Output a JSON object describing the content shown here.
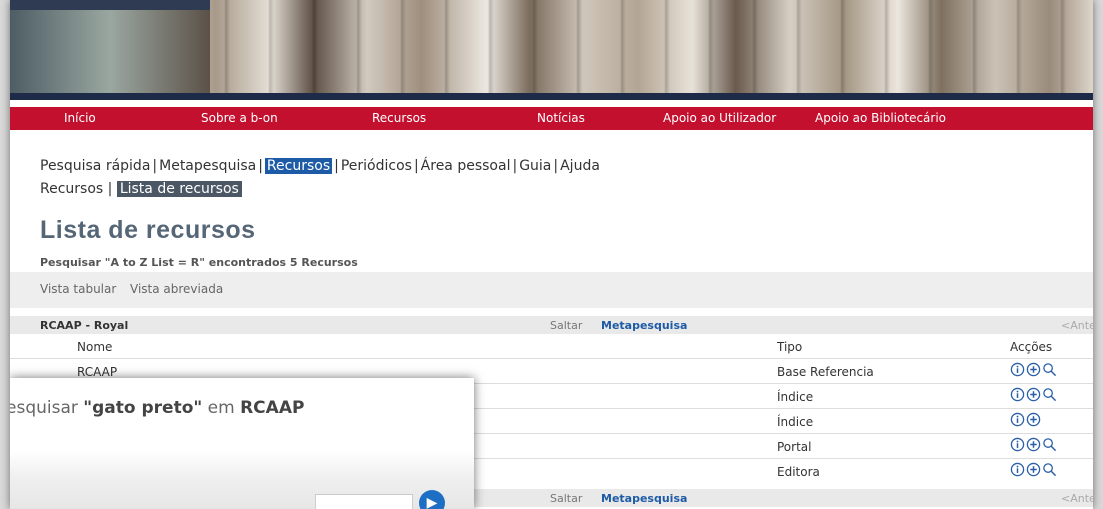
{
  "nav": {
    "items": [
      "Início",
      "Sobre a b-on",
      "Recursos",
      "Notícias",
      "Apoio ao Utilizador",
      "Apoio ao Bibliotecário"
    ]
  },
  "tabs": {
    "items": [
      "Pesquisa rápida",
      "Metapesquisa",
      "Recursos",
      "Periódicos",
      "Área pessoal",
      "Guia",
      "Ajuda"
    ],
    "active": "Recursos"
  },
  "breadcrumb": {
    "root": "Recursos",
    "current": "Lista de recursos"
  },
  "page": {
    "title": "Lista de recursos",
    "subtitle": "Pesquisar \"A to Z List = R\" encontrados 5 Recursos"
  },
  "views": {
    "tabular": "Vista tabular",
    "abreviada": "Vista abreviada"
  },
  "group": {
    "name": "RCAAP - Royal",
    "saltar": "Saltar",
    "metapesquisa": "Metapesquisa",
    "anterior": "<Anter"
  },
  "columns": {
    "nome": "Nome",
    "tipo": "Tipo",
    "accoes": "Acções"
  },
  "rows": [
    {
      "nome": "RCAAP",
      "tipo": "Base Referencia",
      "icons": [
        "info-icon",
        "add-icon",
        "search-icon"
      ]
    },
    {
      "nome": "",
      "tipo": "Índice",
      "icons": [
        "info-icon",
        "add-icon",
        "search-icon"
      ]
    },
    {
      "nome": "",
      "tipo": "Índice",
      "icons": [
        "info-icon",
        "add-icon"
      ]
    },
    {
      "nome": "",
      "tipo": "Portal",
      "icons": [
        "info-icon",
        "add-icon",
        "search-icon"
      ]
    },
    {
      "nome": "",
      "tipo": "Editora",
      "icons": [
        "info-icon",
        "add-icon",
        "search-icon"
      ]
    }
  ],
  "popup": {
    "prefix": "esquisar",
    "query": "\"gato preto\"",
    "middle": "em",
    "target": "RCAAP"
  },
  "colors": {
    "nav_red": "#c3102f",
    "active_blue": "#1d5ba6",
    "icon_blue": "#2a5fa8"
  }
}
